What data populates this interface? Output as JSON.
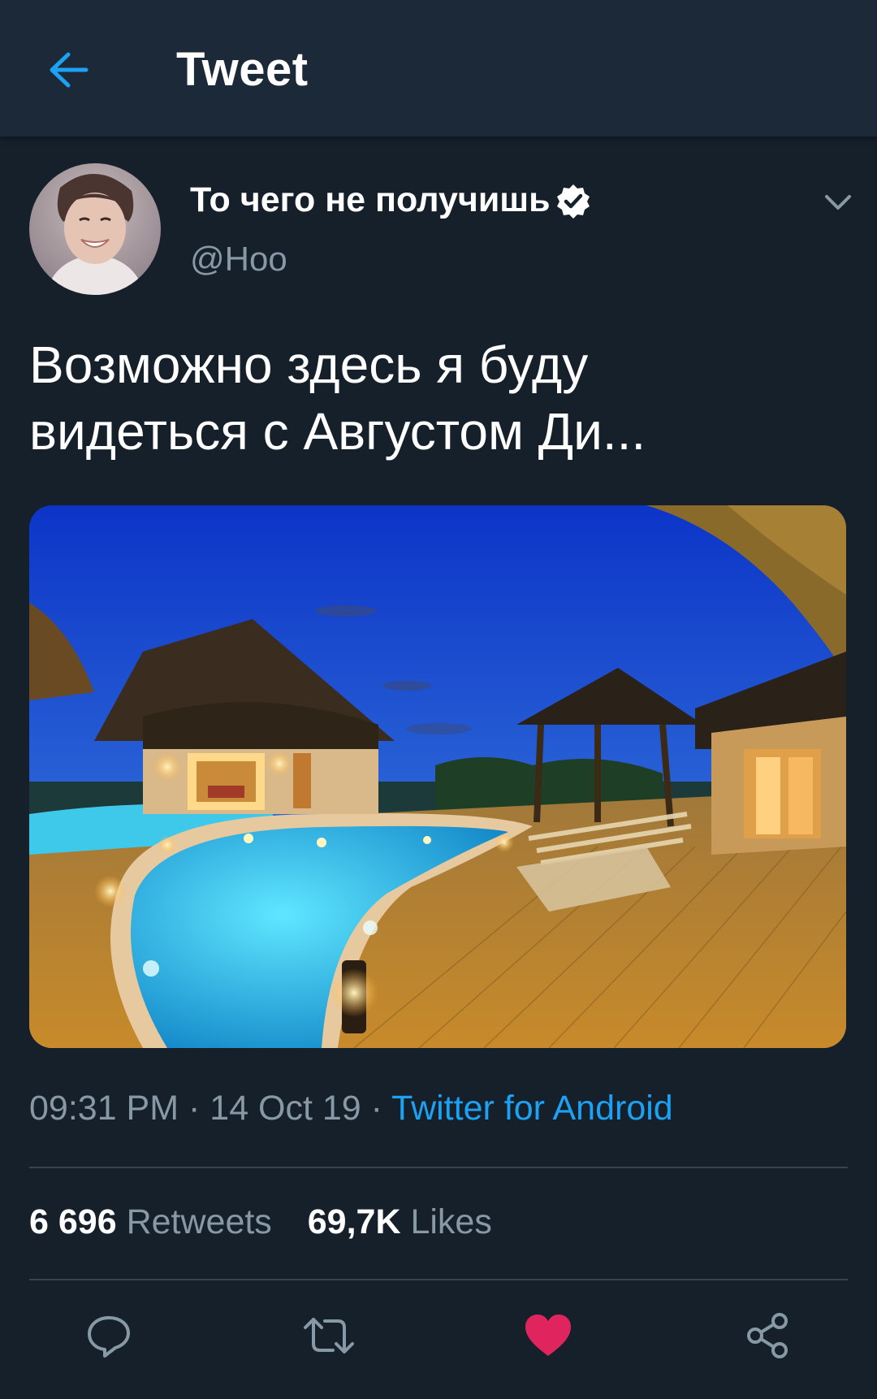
{
  "header": {
    "title": "Tweet",
    "back_icon": "arrow-left-icon"
  },
  "tweet": {
    "author_name": "То чего не получишь",
    "handle": "@Hoo",
    "verified": true,
    "text_line1": "Возможно здесь я буду",
    "text_line2": "видеться с Августом Ди...",
    "time": "09:31 PM",
    "date": "14 Oct 19",
    "separator": " · ",
    "source": "Twitter for Android",
    "retweets_count": "6 696",
    "retweets_label": "Retweets",
    "likes_count": "69,7K",
    "likes_label": "Likes",
    "liked": true
  },
  "colors": {
    "background": "#15202b",
    "header_bg": "#1c2938",
    "accent": "#1da1f2",
    "muted": "#8899a6",
    "like_red": "#e0245e"
  },
  "actions": [
    "reply-icon",
    "retweet-icon",
    "heart-icon",
    "share-icon"
  ]
}
